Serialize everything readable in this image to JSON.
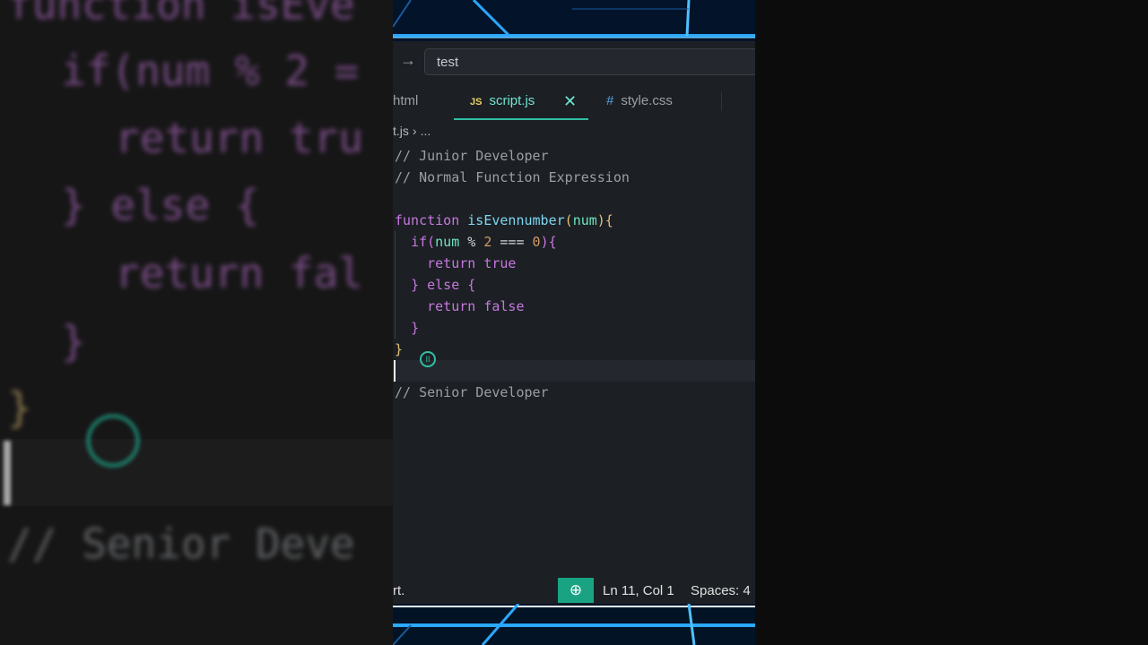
{
  "search": {
    "value": "test"
  },
  "tabs": [
    {
      "label": "html"
    },
    {
      "label": "script.js",
      "badge": "JS",
      "active": true
    },
    {
      "label": "style.css",
      "badge": "#"
    }
  ],
  "breadcrumb": {
    "file": "t.js",
    "rest": "..."
  },
  "code": {
    "line1": "// Junior Developer",
    "line2": "// Normal Function Expression",
    "line_senior": "// Senior Developer"
  },
  "background_code": {
    "l1": "function isEve",
    "l2": "if(num % 2 =",
    "l3": "return tru",
    "l4": "} else {",
    "l5": "return fal",
    "l6": "}",
    "l7": "}",
    "l8": "// Senior Deve"
  },
  "statusbar": {
    "left": "rt.",
    "position": "Ln 11, Col 1",
    "spaces": "Spaces: 4"
  },
  "icons": {
    "arrow": "arrow-right-icon",
    "close": "close-icon",
    "zoom": "zoom-in-icon",
    "gutter": "breakpoint-icon"
  },
  "colors": {
    "accent": "#2fbfa4",
    "keyword": "#c678dd",
    "function": "#7ed6f0",
    "comment": "#9b9ea3"
  }
}
